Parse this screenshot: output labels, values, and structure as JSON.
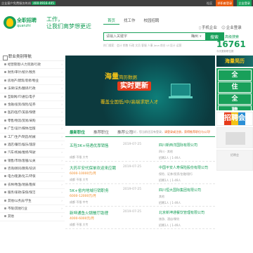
{
  "topbar": {
    "welcome": "企业客户免费服务热线",
    "phone": "400-0916-405",
    "links": [
      "社区",
      "求职者登录",
      "企业登录"
    ]
  },
  "logo": {
    "cn": "全职招聘",
    "en": "quanzhi"
  },
  "slogan": {
    "line1": "工作，",
    "line2": "让我们离梦想更近"
  },
  "nav": {
    "items": [
      "首页",
      "找工作",
      "校园招聘"
    ],
    "active_index": 0
  },
  "search": {
    "placeholder": "请输入关键字",
    "city": "梅州",
    "button": "搜索",
    "advanced": "高级搜索"
  },
  "search_links": "热门搜索：会计 销售 行政 文员 客服 人事 Java 前台 UI 设计 运营",
  "right_links": {
    "mobile": "手机企业",
    "register": "企业登录"
  },
  "stats": {
    "job_count": "16761",
    "job_count_label": "今天更新职位数"
  },
  "sidebar": {
    "title": "职业类别导航",
    "items": [
      "经营管理/人力资源/行政",
      "财务/审计/统计/税务",
      "房地产/建筑/装修/物业",
      "法律/法务/翻译/行政",
      "互联网/IT/通信/电子",
      "金融/投资/保险/证券",
      "医药/医疗/美容/保健",
      "零售/物流/贸易/采购",
      "广告/设计/媒体/出版",
      "工厂/生产/制造/机械",
      "酒店/餐饮/娱乐/旅游",
      "汽车/机械/维修/驾驶",
      "销售/市场/客服/公关",
      "咨询/顾问/教育/培训",
      "电力/能源/化工/环保",
      "农林/牧渔/地质/勘探",
      "服务/家政/安保/保洁",
      "其他/公务员/学生",
      "不限/其他行业",
      "其他"
    ]
  },
  "banner": {
    "line1": "海量",
    "line1_small": "简历数据",
    "line2": "实时更新",
    "line3": "覆盖全国低/中/高端求职人才"
  },
  "tabs": {
    "items": [
      "最新职位",
      "推荐职位",
      "推荐公司"
    ],
    "active_index": 0
  },
  "notice": {
    "text": "您好，您当前还没有登录，",
    "action": "请登录或注册，获得推荐职位与公司!"
  },
  "jobs": [
    {
      "name": "五险3K+待遇优厚销售",
      "date": "2019-07-25",
      "company": "四川新西洋国际有限公司",
      "salary": "",
      "meta": "成都 不限 大专",
      "cmeta": "四川 · 其他",
      "stat": "招聘2人 | 1-49人"
    },
    {
      "name": "大药平安代保单欢迎来应聘",
      "date": "2019-07-25",
      "company": "中国平安人寿保险股份有限公司",
      "salary": "6000-10000元/月",
      "meta": "成都 不限 大专",
      "cmeta": "保险、证券/投资/金融/银行",
      "stat": "招聘1人 | 1-49人"
    },
    {
      "name": "5K+省内地域行销职务",
      "date": "2019-07-25",
      "company": "四川恒大国际集团有限公司",
      "salary": "6000-12000元/月",
      "meta": "成都 不限 中专",
      "cmeta": "其他",
      "stat": "招聘1人 | 1-49人"
    },
    {
      "name": "新坤通鱼火锅餐厅助理",
      "date": "2019-07-25",
      "company": "北京新坤通餐饮管理有限公司",
      "salary": "4000-6000元/月",
      "meta": "成都 不限 大专",
      "cmeta": "旅游、酒店/餐饮",
      "stat": "招聘1人 | 1-49人"
    }
  ],
  "right_ads": {
    "ad1": "海量简历",
    "ad2": [
      "全",
      "住",
      "全",
      "聘"
    ],
    "ad3": [
      "招",
      "聘",
      "会"
    ],
    "ad5": "招聘会"
  },
  "colors": {
    "brand": "#19a05a",
    "accent": "#e95a0c",
    "salary": "#f08a24"
  }
}
